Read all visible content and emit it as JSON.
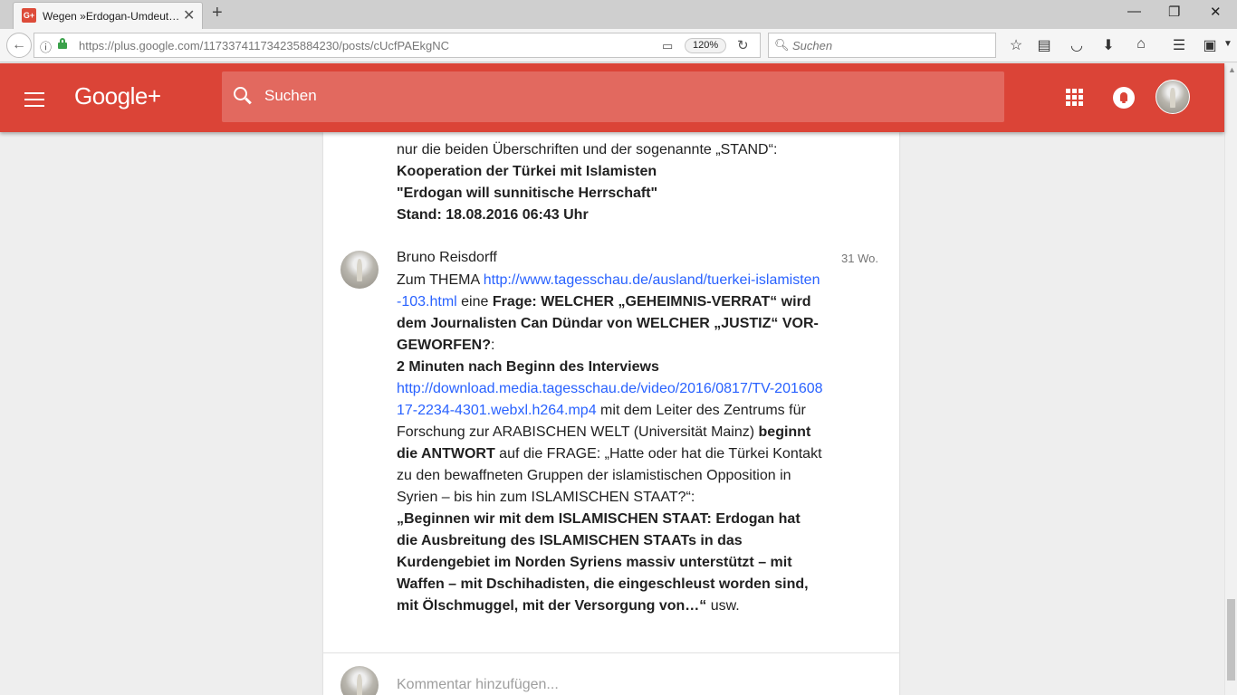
{
  "browser": {
    "tab_title": "Wegen »Erdogan-Umdeut…",
    "tab_favicon": "G+",
    "url_host": "https://plus.google.com",
    "url_path": "/117337411734235884230/posts/cUcfPAEkgNC",
    "zoom": "120%",
    "search_placeholder": "Suchen"
  },
  "header": {
    "logo": "Google+",
    "search_placeholder": "Suchen",
    "accent_color": "#db4437"
  },
  "previous_comment": {
    "intro": "nur die beiden Überschriften und der sogenannte „STAND“:",
    "line1": "Kooperation der Türkei mit Islamisten",
    "line2": "\"Erdogan will sunnitische Herrschaft\"",
    "line3": "Stand: 18.08.2016 06:43 Uhr"
  },
  "comment": {
    "author": "Bruno Reisdorff",
    "time": "31 Wo.",
    "p1": "Zum THEMA ",
    "link1": "http://www.tagesschau.de/ausland/tuerkei-islamisten-103.html",
    "p2": " eine ",
    "b1": "Frage: WELCHER „GEHEIMNIS-VERRAT“ wird dem Journalisten Can Dündar von WELCHER „JUSTIZ“ VOR-GEWORFEN?",
    "p3": ":",
    "b2": "2 Minuten nach Beginn des Interviews",
    "link2": "http://download.media.tagesschau.de/video/2016/0817/TV-20160817-2234-4301.webxl.h264.mp4",
    "p4": " mit dem Leiter des Zentrums für Forschung zur ARABISCHEN WELT (Universität Mainz) ",
    "b3": "beginnt die ANTWORT",
    "p5": " auf die FRAGE: „Hatte oder hat die Türkei Kontakt zu den bewaffneten Gruppen der islamistischen Opposition in Syrien – bis hin zum ISLAMISCHEN STAAT?“:",
    "b4": "„Beginnen wir mit dem ISLAMISCHEN STAAT: Erdogan hat die Ausbreitung des ISLAMISCHEN STAATs in das Kurdengebiet im Norden Syriens massiv unterstützt – mit Waffen – mit Dschihadisten, die eingeschleust worden sind, mit Ölschmuggel, mit der Versorgung von…“",
    "p6": " usw."
  },
  "add_comment_placeholder": "Kommentar hinzufügen..."
}
